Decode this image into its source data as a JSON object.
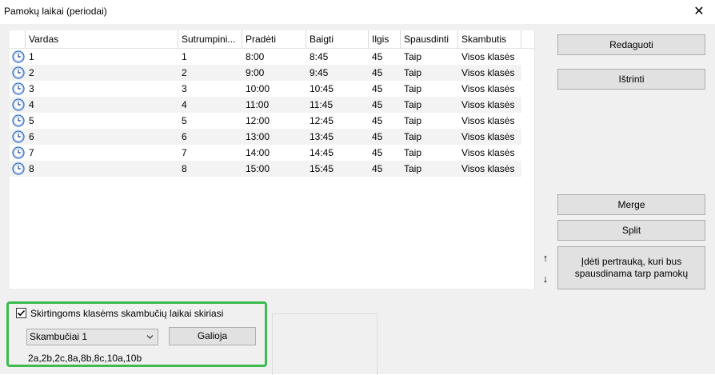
{
  "window": {
    "title": "Pamokų laikai (periodai)",
    "close_glyph": "✕"
  },
  "table": {
    "columns": [
      "Vardas",
      "Sutrumpini...",
      "Pradėti",
      "Baigti",
      "Ilgis",
      "Spausdinti",
      "Skambutis"
    ],
    "rows": [
      {
        "icon": "clock-icon",
        "name": "1",
        "short": "1",
        "start": "8:00",
        "end": "8:45",
        "length": "45",
        "print": "Taip",
        "bell": "Visos klasės"
      },
      {
        "icon": "clock-icon",
        "name": "2",
        "short": "2",
        "start": "9:00",
        "end": "9:45",
        "length": "45",
        "print": "Taip",
        "bell": "Visos klasės"
      },
      {
        "icon": "clock-icon",
        "name": "3",
        "short": "3",
        "start": "10:00",
        "end": "10:45",
        "length": "45",
        "print": "Taip",
        "bell": "Visos klasės"
      },
      {
        "icon": "clock-icon",
        "name": "4",
        "short": "4",
        "start": "11:00",
        "end": "11:45",
        "length": "45",
        "print": "Taip",
        "bell": "Visos klasės"
      },
      {
        "icon": "clock-icon",
        "name": "5",
        "short": "5",
        "start": "12:00",
        "end": "12:45",
        "length": "45",
        "print": "Taip",
        "bell": "Visos klasės"
      },
      {
        "icon": "clock-icon",
        "name": "6",
        "short": "6",
        "start": "13:00",
        "end": "13:45",
        "length": "45",
        "print": "Taip",
        "bell": "Visos klasės"
      },
      {
        "icon": "clock-icon",
        "name": "7",
        "short": "7",
        "start": "14:00",
        "end": "14:45",
        "length": "45",
        "print": "Taip",
        "bell": "Visos klasės"
      },
      {
        "icon": "clock-icon",
        "name": "8",
        "short": "8",
        "start": "15:00",
        "end": "15:45",
        "length": "45",
        "print": "Taip",
        "bell": "Visos klasės"
      }
    ]
  },
  "buttons": {
    "edit": "Redaguoti",
    "delete": "Ištrinti",
    "merge": "Merge",
    "split": "Split",
    "insert_break_line1": "Įdėti pertrauką, kuri bus",
    "insert_break_line2": "spausdinama tarp pamokų",
    "move_up": "↑",
    "move_down": "↓"
  },
  "bell_section": {
    "checkbox_label": "Skirtingoms klasėms skambučių laikai skiriasi",
    "checkbox_checked": true,
    "select_value": "Skambučiai 1",
    "applies_button": "Galioja",
    "classes": "2a,2b,2c,8a,8b,8c,10a,10b"
  },
  "colors": {
    "highlight_border": "#3dbb4e",
    "button_face": "#e1e1e1",
    "alt_row": "#f3f3f3"
  }
}
